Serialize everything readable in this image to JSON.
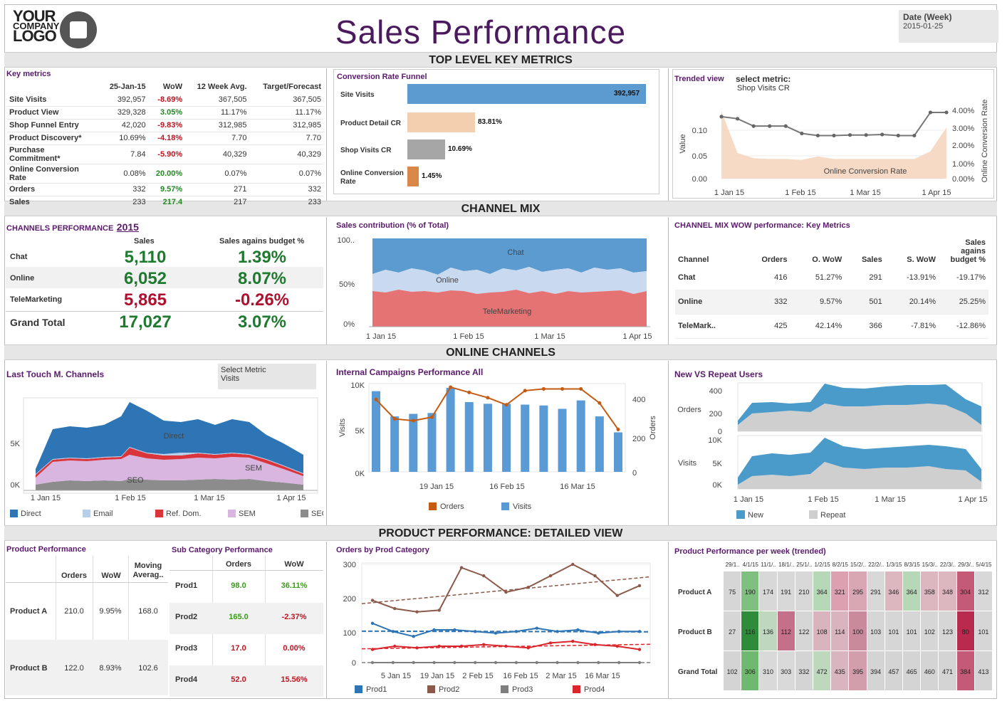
{
  "header": {
    "logo_text": [
      "YOUR",
      "COMPANY",
      "LOGO"
    ],
    "title": "Sales Performance",
    "date_label": "Date (Week)",
    "date_value": "2015-01-25"
  },
  "bands": {
    "top": "TOP LEVEL KEY METRICS",
    "mix": "CHANNEL MIX",
    "online": "ONLINE CHANNELS",
    "product": "PRODUCT PERFORMANCE: DETAILED VIEW"
  },
  "key_metrics": {
    "title": "Key metrics",
    "columns": [
      "25-Jan-15",
      "WoW",
      "12 Week Avg.",
      "Target/Forecast"
    ],
    "rows": [
      {
        "name": "Site Visits",
        "v": "392,957",
        "wow": "-8.69%",
        "avg": "367,505",
        "tgt": "367,505",
        "pos": false
      },
      {
        "name": "Product View",
        "v": "329,328",
        "wow": "3.05%",
        "avg": "11.17%",
        "tgt": "11.17%",
        "pos": true
      },
      {
        "name": "Shop Funnel Entry",
        "v": "42,020",
        "wow": "-9.83%",
        "avg": "312,985",
        "tgt": "312,985",
        "pos": false
      },
      {
        "name": "Product Discovery*",
        "v": "10.69%",
        "wow": "-4.18%",
        "avg": "7.70",
        "tgt": "7.70",
        "pos": false
      },
      {
        "name": "Purchase Commitment*",
        "v": "7.84",
        "wow": "-5.90%",
        "avg": "40,329",
        "tgt": "40,329",
        "pos": false
      },
      {
        "name": "Online Conversion Rate",
        "v": "0.08%",
        "wow": "20.00%",
        "avg": "0.07%",
        "tgt": "0.07%",
        "pos": true
      },
      {
        "name": "Orders",
        "v": "332",
        "wow": "9.57%",
        "avg": "271",
        "tgt": "332",
        "pos": true
      },
      {
        "name": "Sales",
        "v": "233",
        "wow": "217.4",
        "avg": "217",
        "tgt": "233",
        "pos": true
      }
    ]
  },
  "funnel": {
    "title": "Conversion Rate Funnel",
    "rows": [
      {
        "label": "Site Visits",
        "value": "392,957",
        "frac": 1.0,
        "color": "#5b9bd0"
      },
      {
        "label": "Product Detail CR",
        "value": "83.81%",
        "frac": 0.2838,
        "color": "#f3cfb0"
      },
      {
        "label": "Shop Visits CR",
        "value": "10.69%",
        "frac": 0.1588,
        "color": "#a6a6a6"
      },
      {
        "label": "Online Conversion Rate",
        "value": "1.45%",
        "frac": 0.0441,
        "color": "#d9884a"
      }
    ]
  },
  "trended": {
    "title": "Trended view",
    "select_label": "select metric:",
    "select_value": "Shop Visits CR",
    "ylabel": "Value",
    "y2label": "Online Conversion Rate",
    "area_label": "Online Conversion Rate",
    "yticks": [
      "0.10",
      "0.05",
      "0.00"
    ],
    "y2ticks": [
      "4.00%",
      "3.00%",
      "2.00%",
      "1.00%",
      "0.00%"
    ],
    "xticks": [
      "1 Jan 15",
      "1 Feb 15",
      "1 Mar 15",
      "1 Apr 15"
    ]
  },
  "channels_perf": {
    "title": "CHANNELS PERFORMANCE",
    "year": "2015",
    "columns": [
      "Sales",
      "Sales agains budget %"
    ],
    "rows": [
      {
        "name": "Chat",
        "sales": "5,110",
        "pct": "1.39%",
        "s_pos": true,
        "p_pos": true
      },
      {
        "name": "Online",
        "sales": "6,052",
        "pct": "8.07%",
        "s_pos": true,
        "p_pos": true
      },
      {
        "name": "TeleMarketing",
        "sales": "5,865",
        "pct": "-0.26%",
        "s_pos": false,
        "p_pos": false
      }
    ],
    "total": {
      "name": "Grand Total",
      "sales": "17,027",
      "pct": "3.07%"
    }
  },
  "sales_contrib": {
    "title": "Sales contribution (% of Total)",
    "yticks": [
      "100..",
      "50%",
      "0%"
    ],
    "xticks": [
      "1 Jan 15",
      "1 Feb 15",
      "1 Mar 15",
      "1 Apr 15"
    ],
    "labels": [
      "Chat",
      "Online",
      "TeleMarketing"
    ]
  },
  "mix_wow": {
    "title": "CHANNEL MIX WOW performance: Key Metrics",
    "columns": [
      "Channel",
      "Orders",
      "O. WoW",
      "Sales",
      "S. WoW",
      "Sales agains budget %"
    ],
    "rows": [
      [
        "Chat",
        "416",
        "51.27%",
        "291",
        "-13.91%",
        "-19.17%"
      ],
      [
        "Online",
        "332",
        "9.57%",
        "501",
        "20.14%",
        "25.25%"
      ],
      [
        "TeleMark..",
        "425",
        "42.14%",
        "366",
        "-7.81%",
        "-12.86%"
      ]
    ]
  },
  "last_touch": {
    "title": "Last Touch M. Channels",
    "select_label": "Select Metric",
    "select_value": "Visits",
    "yticks": [
      "5K",
      "0K"
    ],
    "xticks": [
      "1 Jan 15",
      "1 Feb 15",
      "1 Mar 15",
      "1 Apr 15"
    ],
    "area_labels": [
      "Direct",
      "SEM",
      "SEO"
    ],
    "legend": [
      {
        "name": "Direct",
        "color": "#2e75b6"
      },
      {
        "name": "Email",
        "color": "#b8cfea"
      },
      {
        "name": "Ref. Dom.",
        "color": "#d9353b"
      },
      {
        "name": "SEM",
        "color": "#d8b6e0"
      },
      {
        "name": "SEO",
        "color": "#8c8c8c"
      }
    ]
  },
  "campaigns": {
    "title": "Internal Campaigns Performance All",
    "ylabel": "Visits",
    "y2label": "Orders",
    "yticks": [
      "10K",
      "5K",
      "0K"
    ],
    "y2ticks": [
      "400",
      "200",
      "0"
    ],
    "xticks": [
      "19 Jan 15",
      "16 Feb 15",
      "16 Mar 15"
    ],
    "legend": [
      {
        "name": "Orders",
        "color": "#c55a11"
      },
      {
        "name": "Visits",
        "color": "#5b9bd5"
      }
    ]
  },
  "new_repeat": {
    "title": "New VS Repeat Users",
    "orders_label": "Orders",
    "visits_label": "Visits",
    "orders_ticks": [
      "400",
      "200",
      "0"
    ],
    "visits_ticks": [
      "10K",
      "5K",
      "0K"
    ],
    "xticks": [
      "1 Jan 15",
      "1 Feb 15",
      "1 Mar 15",
      "1 Apr 15"
    ],
    "legend": [
      {
        "name": "New",
        "color": "#4a9bc9"
      },
      {
        "name": "Repeat",
        "color": "#cfcfcf"
      }
    ]
  },
  "product_perf": {
    "title": "Product  Performance",
    "columns": [
      "Orders",
      "WoW",
      "Moving Averag.."
    ],
    "rows": [
      {
        "name": "Product A",
        "orders": "210.0",
        "wow": "9.95%",
        "ma": "168.0"
      },
      {
        "name": "Product B",
        "orders": "122.0",
        "wow": "8.93%",
        "ma": "102.6"
      }
    ]
  },
  "subcat": {
    "title": "Sub Category Performance",
    "columns": [
      "Orders",
      "WoW"
    ],
    "rows": [
      {
        "name": "Prod1",
        "orders": "98.0",
        "wow": "36.11%",
        "pos": true
      },
      {
        "name": "Prod2",
        "orders": "165.0",
        "wow": "-2.37%",
        "pos": false
      },
      {
        "name": "Prod3",
        "orders": "17.0",
        "wow": "0.00%",
        "pos": false
      },
      {
        "name": "Prod4",
        "orders": "52.0",
        "wow": "15.56%",
        "pos": false
      }
    ]
  },
  "orders_cat": {
    "title": "Orders by Prod Category",
    "yticks": [
      "300",
      "200",
      "100",
      "0"
    ],
    "xticks": [
      "5 Jan 15",
      "19 Jan 15",
      "2 Feb 15",
      "16 Feb 15",
      "2 Mar 15",
      "16 Mar 15"
    ],
    "legend": [
      {
        "name": "Prod1",
        "color": "#2e75b6"
      },
      {
        "name": "Prod2",
        "color": "#8b5a4a"
      },
      {
        "name": "Prod3",
        "color": "#7f7f7f"
      },
      {
        "name": "Prod4",
        "color": "#d9252b"
      }
    ]
  },
  "heatmap": {
    "title": "Product Performance per week (trended)",
    "columns": [
      "29/1..",
      "4/1/15",
      "11/1/..",
      "18/1/..",
      "25/1/..",
      "1/2/15",
      "8/2/15",
      "15/2/..",
      "22/2/..",
      "1/3/15",
      "8/3/15",
      "15/3/..",
      "22/3/..",
      "29/3/..",
      "5/4/15"
    ],
    "rows": [
      {
        "name": "Product A",
        "values": [
          "75",
          "190",
          "174",
          "191",
          "210",
          "364",
          "321",
          "295",
          "291",
          "346",
          "364",
          "358",
          "348",
          "304",
          "312"
        ]
      },
      {
        "name": "Product B",
        "values": [
          "27",
          "116",
          "136",
          "112",
          "122",
          "108",
          "114",
          "100",
          "103",
          "101",
          "101",
          "102",
          "123",
          "80",
          "101"
        ]
      },
      {
        "name": "Grand Total",
        "values": [
          "102",
          "306",
          "310",
          "303",
          "332",
          "472",
          "435",
          "395",
          "394",
          "457",
          "465",
          "460",
          "471",
          "384",
          "413"
        ]
      }
    ]
  },
  "chart_data": [
    {
      "type": "bar",
      "title": "Conversion Rate Funnel",
      "categories": [
        "Site Visits",
        "Product Detail CR",
        "Shop Visits CR",
        "Online Conversion Rate"
      ],
      "values": [
        "392,957",
        "83.81%",
        "10.69%",
        "1.45%"
      ]
    },
    {
      "type": "line",
      "title": "Trended view",
      "x": [
        "1 Jan 15",
        "8 Jan 15",
        "15 Jan 15",
        "22 Jan 15",
        "29 Jan 15",
        "5 Feb 15",
        "12 Feb 15",
        "19 Feb 15",
        "26 Feb 15",
        "5 Mar 15",
        "12 Mar 15",
        "19 Mar 15",
        "26 Mar 15",
        "2 Apr 15",
        "9 Apr 15"
      ],
      "series": [
        {
          "name": "Shop Visits CR",
          "values": [
            0.118,
            0.114,
            0.1,
            0.1,
            0.1,
            0.086,
            0.082,
            0.082,
            0.083,
            0.083,
            0.084,
            0.082,
            0.082,
            0.126,
            0.126
          ]
        },
        {
          "name": "Online Conversion Rate",
          "values": [
            3.95,
            1.5,
            1.2,
            1.15,
            1.15,
            1.1,
            1.3,
            1.15,
            1.15,
            1.15,
            1.15,
            1.15,
            1.15,
            1.6,
            3.0
          ]
        }
      ]
    },
    {
      "type": "area",
      "title": "Sales contribution (% of Total)",
      "x": [
        "1 Jan 15",
        "1 Feb 15",
        "1 Mar 15",
        "1 Apr 15"
      ],
      "series": [
        {
          "name": "TeleMarketing",
          "values": [
            38,
            35,
            36,
            40
          ]
        },
        {
          "name": "Online",
          "values": [
            28,
            32,
            30,
            30
          ]
        },
        {
          "name": "Chat",
          "values": [
            34,
            33,
            34,
            30
          ]
        }
      ]
    },
    {
      "type": "area",
      "title": "Last Touch M. Channels",
      "x": [
        "1 Jan 15",
        "1 Feb 15",
        "1 Mar 15",
        "1 Apr 15"
      ],
      "series": [
        {
          "name": "SEO",
          "values": [
            800,
            1100,
            1100,
            600
          ]
        },
        {
          "name": "SEM",
          "values": [
            1800,
            2200,
            2100,
            1000
          ]
        },
        {
          "name": "Ref. Dom.",
          "values": [
            200,
            200,
            200,
            100
          ]
        },
        {
          "name": "Email",
          "values": [
            0,
            100,
            200,
            100
          ]
        },
        {
          "name": "Direct",
          "values": [
            2800,
            4500,
            4200,
            1600
          ]
        }
      ]
    },
    {
      "type": "bar",
      "title": "Internal Campaigns Performance All",
      "series": [
        {
          "name": "Visits",
          "values": [
            9600,
            6600,
            6900,
            7000,
            10000,
            8300,
            8100,
            8100,
            8000,
            7900,
            7500,
            8500,
            6600,
            4700
          ]
        },
        {
          "name": "Orders",
          "values": [
            410,
            300,
            290,
            310,
            480,
            450,
            420,
            380,
            460,
            470,
            470,
            470,
            390,
            240
          ]
        }
      ]
    },
    {
      "type": "line",
      "title": "Orders by Prod Category",
      "x": [
        "5 Jan 15",
        "19 Jan 15",
        "2 Feb 15",
        "16 Feb 15",
        "2 Mar 15",
        "16 Mar 15"
      ],
      "series": [
        {
          "name": "Prod1",
          "values": [
            120,
            95,
            80,
            100,
            100,
            95,
            90,
            95,
            105,
            95,
            100,
            90,
            95,
            95
          ]
        },
        {
          "name": "Prod2",
          "values": [
            190,
            165,
            155,
            160,
            290,
            265,
            215,
            230,
            265,
            300,
            265,
            205,
            235
          ]
        },
        {
          "name": "Prod3",
          "values": [
            0,
            0,
            0,
            0,
            0,
            0,
            0,
            0,
            0,
            0,
            0,
            0,
            0,
            0
          ]
        },
        {
          "name": "Prod4",
          "values": [
            40,
            50,
            45,
            50,
            50,
            55,
            50,
            45,
            60,
            65,
            55,
            50,
            40
          ]
        }
      ]
    }
  ]
}
